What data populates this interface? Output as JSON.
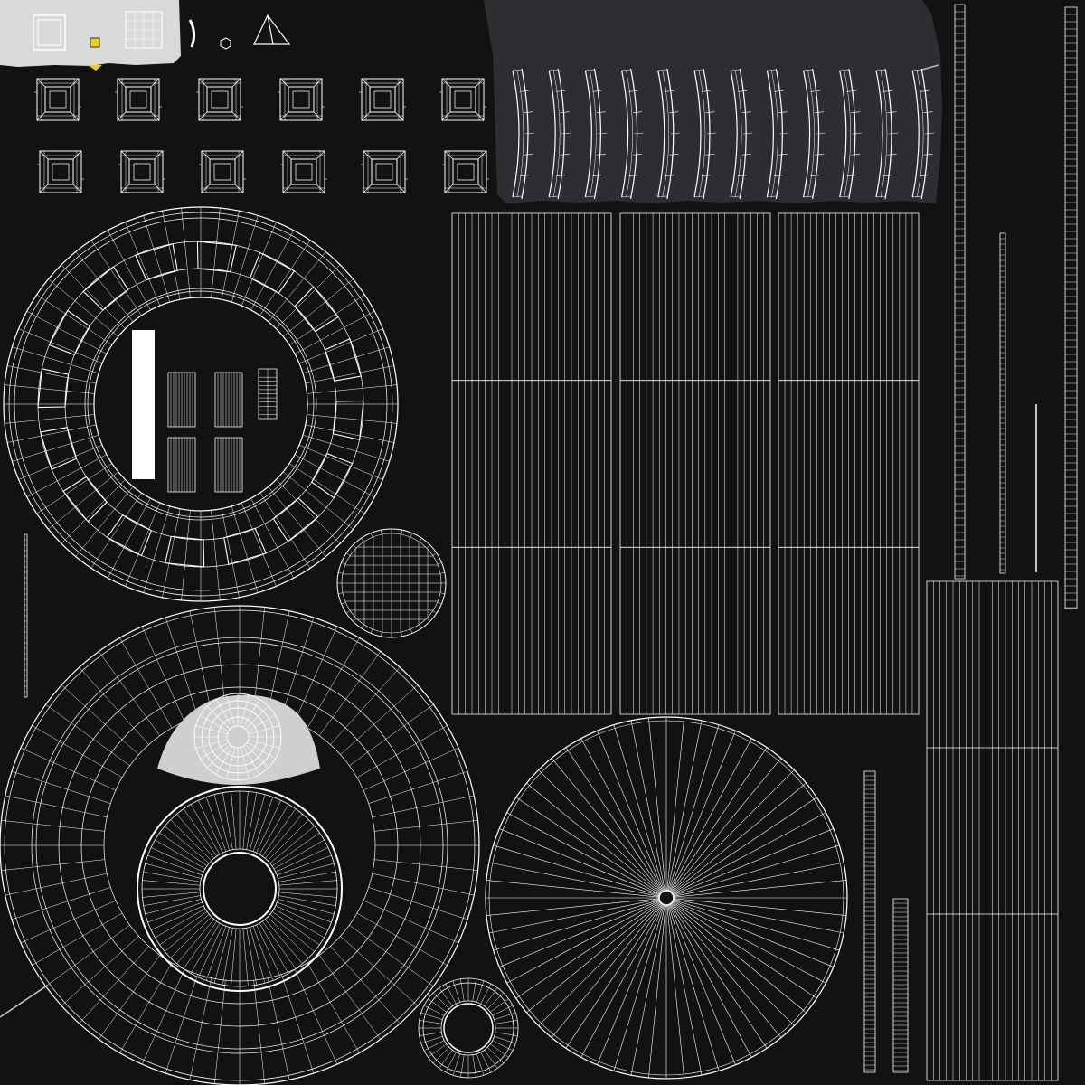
{
  "view": {
    "background": "#121212",
    "wire_color": "#ffffff",
    "fill_light": "#cfcfcf",
    "fill_panel": "#2d2e32",
    "accent_yellow": "#e8d21e"
  },
  "islands": [
    {
      "name": "top-left-light-island",
      "kind": "light-block"
    },
    {
      "name": "top-small-icons",
      "kind": "small-shapes"
    },
    {
      "name": "frame-tile-row-1",
      "kind": "frame-tiles",
      "count": 6
    },
    {
      "name": "frame-tile-row-2",
      "kind": "frame-tiles",
      "count": 6
    },
    {
      "name": "curved-strip-panel",
      "kind": "curved-strips",
      "count": 12
    },
    {
      "name": "ring-island-top",
      "kind": "segmented-ring"
    },
    {
      "name": "inner-center-parts",
      "kind": "small-grids"
    },
    {
      "name": "small-circle-island",
      "kind": "grid-circle"
    },
    {
      "name": "large-ring-island",
      "kind": "radial-ring"
    },
    {
      "name": "half-disc-island",
      "kind": "half-disc"
    },
    {
      "name": "inner-hub-ring",
      "kind": "radial-ring"
    },
    {
      "name": "small-donut-island",
      "kind": "radial-ring"
    },
    {
      "name": "fan-disc-island",
      "kind": "radial-fan",
      "spokes": 64
    },
    {
      "name": "grid-panels",
      "kind": "rect-grid",
      "count": 3
    },
    {
      "name": "right-tall-grid",
      "kind": "rect-grid"
    },
    {
      "name": "vertical-strips",
      "kind": "thin-strips"
    }
  ]
}
